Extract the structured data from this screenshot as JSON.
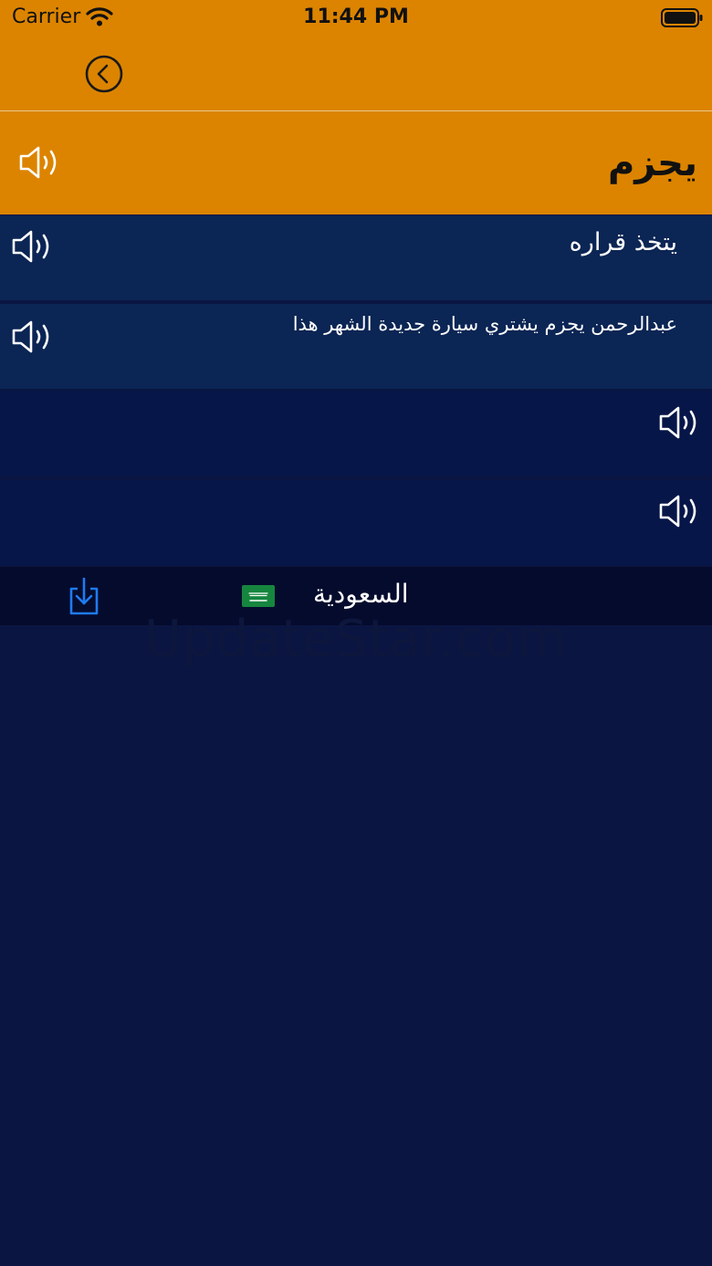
{
  "status_bar": {
    "carrier": "Carrier",
    "time": "11:44 PM"
  },
  "header": {
    "word": "يجزم"
  },
  "rows": [
    {
      "text": "يتخذ قراره",
      "speaker_side": "left",
      "color": "#0b2554"
    },
    {
      "text": "عبدالرحمن يجزم يشتري سيارة جديدة الشهر هذا",
      "speaker_side": "left",
      "color": "#0b2554"
    },
    {
      "text": "",
      "speaker_side": "right",
      "color": "#071648"
    },
    {
      "text": "",
      "speaker_side": "right",
      "color": "#071648"
    }
  ],
  "language_bar": {
    "language": "السعودية",
    "flag": "saudi-arabia-flag",
    "download_icon": "download-icon"
  },
  "watermark": "UpdateStar.com",
  "colors": {
    "accent": "#dc8400",
    "download_blue": "#1e7bf0",
    "background": "#0a1542"
  }
}
